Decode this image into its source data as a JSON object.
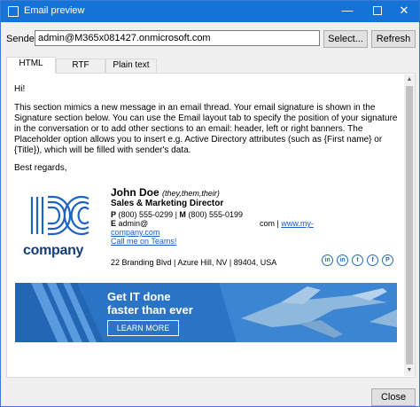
{
  "window": {
    "title": "Email preview",
    "minimize": "—",
    "close": "✕"
  },
  "sender": {
    "label": "Sender:",
    "value": "admin@M365x081427.onmicrosoft.com",
    "select_label": "Select...",
    "refresh_label": "Refresh"
  },
  "tabs": [
    {
      "label": "HTML"
    },
    {
      "label": "RTF"
    },
    {
      "label": "Plain text"
    }
  ],
  "email": {
    "greeting": "Hi!",
    "body": "This section mimics a new message in an email thread. Your email signature is shown in the Signature section below. You can use the Email layout tab to specify the position of your signature in the conversation or to add other sections to an email: header, left or right banners. The Placeholder option allows you to insert e.g. Active Directory attributes (such as {First name} or {Title}), which will be filled with sender's data.",
    "regards": "Best regards,"
  },
  "signature": {
    "logo_text": "company",
    "name": "John Doe",
    "pronouns": "(they,them,their)",
    "title": "Sales & Marketing Director",
    "phone_prefix": "P",
    "phone": "(800) 555-0299",
    "mobile_prefix": "M",
    "mobile": "(800) 555-0199",
    "email_prefix": "E",
    "email_left": "admin@",
    "email_right": "com |",
    "web_part1": "www.my-",
    "web_part2": "company.com",
    "teams": "Call me on Teams!",
    "address": "22 Branding Blvd | Azure Hill, NV | 89404, USA",
    "socials": [
      "in",
      "in",
      "t",
      "f",
      "P"
    ]
  },
  "banner": {
    "line1": "Get IT done",
    "line2": "faster than ever",
    "button": "LEARN MORE"
  },
  "footer": {
    "close_label": "Close"
  },
  "colors": {
    "titlebar": "#1473d6",
    "brand_dark": "#153c7a",
    "link": "#1a5cc8",
    "banner": "#2b73c4"
  }
}
